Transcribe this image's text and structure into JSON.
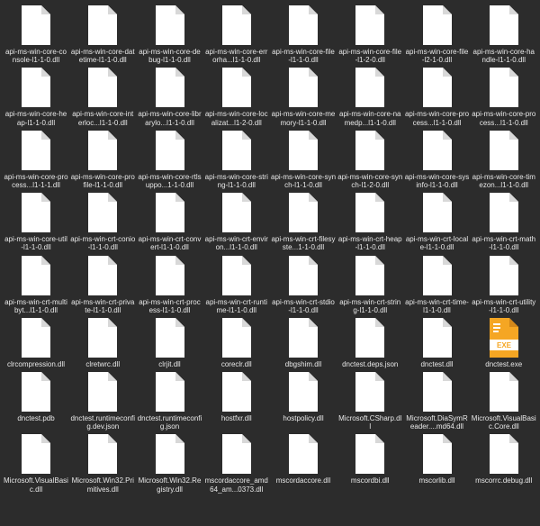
{
  "files": [
    {
      "name": "api-ms-win-core-console-l1-1-0.dll",
      "type": "generic"
    },
    {
      "name": "api-ms-win-core-datetime-l1-1-0.dll",
      "type": "generic"
    },
    {
      "name": "api-ms-win-core-debug-l1-1-0.dll",
      "type": "generic"
    },
    {
      "name": "api-ms-win-core-errorha...l1-1-0.dll",
      "type": "generic"
    },
    {
      "name": "api-ms-win-core-file-l1-1-0.dll",
      "type": "generic"
    },
    {
      "name": "api-ms-win-core-file-l1-2-0.dll",
      "type": "generic"
    },
    {
      "name": "api-ms-win-core-file-l2-1-0.dll",
      "type": "generic"
    },
    {
      "name": "api-ms-win-core-handle-l1-1-0.dll",
      "type": "generic"
    },
    {
      "name": "api-ms-win-core-heap-l1-1-0.dll",
      "type": "generic"
    },
    {
      "name": "api-ms-win-core-interloc...l1-1-0.dll",
      "type": "generic"
    },
    {
      "name": "api-ms-win-core-librarylo...l1-1-0.dll",
      "type": "generic"
    },
    {
      "name": "api-ms-win-core-localizat...l1-2-0.dll",
      "type": "generic"
    },
    {
      "name": "api-ms-win-core-memory-l1-1-0.dll",
      "type": "generic"
    },
    {
      "name": "api-ms-win-core-namedp...l1-1-0.dll",
      "type": "generic"
    },
    {
      "name": "api-ms-win-core-process...l1-1-0.dll",
      "type": "generic"
    },
    {
      "name": "api-ms-win-core-process...l1-1-0.dll",
      "type": "generic"
    },
    {
      "name": "api-ms-win-core-process...l1-1-1.dll",
      "type": "generic"
    },
    {
      "name": "api-ms-win-core-profile-l1-1-0.dll",
      "type": "generic"
    },
    {
      "name": "api-ms-win-core-rtlsuppo...1-1-0.dll",
      "type": "generic"
    },
    {
      "name": "api-ms-win-core-string-l1-1-0.dll",
      "type": "generic"
    },
    {
      "name": "api-ms-win-core-synch-l1-1-0.dll",
      "type": "generic"
    },
    {
      "name": "api-ms-win-core-synch-l1-2-0.dll",
      "type": "generic"
    },
    {
      "name": "api-ms-win-core-sysinfo-l1-1-0.dll",
      "type": "generic"
    },
    {
      "name": "api-ms-win-core-timezon...l1-1-0.dll",
      "type": "generic"
    },
    {
      "name": "api-ms-win-core-util-l1-1-0.dll",
      "type": "generic"
    },
    {
      "name": "api-ms-win-crt-conio-l1-1-0.dll",
      "type": "generic"
    },
    {
      "name": "api-ms-win-crt-convert-l1-1-0.dll",
      "type": "generic"
    },
    {
      "name": "api-ms-win-crt-environ...l1-1-0.dll",
      "type": "generic"
    },
    {
      "name": "api-ms-win-crt-filesyste...1-1-0.dll",
      "type": "generic"
    },
    {
      "name": "api-ms-win-crt-heap-l1-1-0.dll",
      "type": "generic"
    },
    {
      "name": "api-ms-win-crt-locale-l1-1-0.dll",
      "type": "generic"
    },
    {
      "name": "api-ms-win-crt-math-l1-1-0.dll",
      "type": "generic"
    },
    {
      "name": "api-ms-win-crt-multibyt...l1-1-0.dll",
      "type": "generic"
    },
    {
      "name": "api-ms-win-crt-private-l1-1-0.dll",
      "type": "generic"
    },
    {
      "name": "api-ms-win-crt-process-l1-1-0.dll",
      "type": "generic"
    },
    {
      "name": "api-ms-win-crt-runtime-l1-1-0.dll",
      "type": "generic"
    },
    {
      "name": "api-ms-win-crt-stdio-l1-1-0.dll",
      "type": "generic"
    },
    {
      "name": "api-ms-win-crt-string-l1-1-0.dll",
      "type": "generic"
    },
    {
      "name": "api-ms-win-crt-time-l1-1-0.dll",
      "type": "generic"
    },
    {
      "name": "api-ms-win-crt-utility-l1-1-0.dll",
      "type": "generic"
    },
    {
      "name": "clrcompression.dll",
      "type": "generic"
    },
    {
      "name": "clretwrc.dll",
      "type": "generic"
    },
    {
      "name": "clrjit.dll",
      "type": "generic"
    },
    {
      "name": "coreclr.dll",
      "type": "generic"
    },
    {
      "name": "dbgshim.dll",
      "type": "generic"
    },
    {
      "name": "dnctest.deps.json",
      "type": "generic"
    },
    {
      "name": "dnctest.dll",
      "type": "generic"
    },
    {
      "name": "dnctest.exe",
      "type": "exe"
    },
    {
      "name": "dnctest.pdb",
      "type": "generic"
    },
    {
      "name": "dnctest.runtimeconfig.dev.json",
      "type": "generic"
    },
    {
      "name": "dnctest.runtimeconfig.json",
      "type": "generic"
    },
    {
      "name": "hostfxr.dll",
      "type": "generic"
    },
    {
      "name": "hostpolicy.dll",
      "type": "generic"
    },
    {
      "name": "Microsoft.CSharp.dll",
      "type": "generic"
    },
    {
      "name": "Microsoft.DiaSymReader....md64.dll",
      "type": "generic"
    },
    {
      "name": "Microsoft.VisualBasic.Core.dll",
      "type": "generic"
    },
    {
      "name": "Microsoft.VisualBasic.dll",
      "type": "generic"
    },
    {
      "name": "Microsoft.Win32.Primitives.dll",
      "type": "generic"
    },
    {
      "name": "Microsoft.Win32.Registry.dll",
      "type": "generic"
    },
    {
      "name": "mscordaccore_amd64_am...0373.dll",
      "type": "generic"
    },
    {
      "name": "mscordaccore.dll",
      "type": "generic"
    },
    {
      "name": "mscordbi.dll",
      "type": "generic"
    },
    {
      "name": "mscorlib.dll",
      "type": "generic"
    },
    {
      "name": "mscorrc.debug.dll",
      "type": "generic"
    }
  ],
  "icon_types": {
    "generic": {
      "fill": "#ffffff"
    },
    "exe": {
      "fill": "#f5a623",
      "label": "EXE"
    }
  }
}
